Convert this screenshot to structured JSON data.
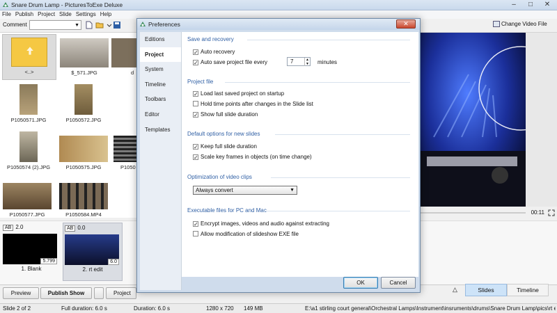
{
  "window": {
    "title": "Snare Drum Lamp - PicturesToExe Deluxe"
  },
  "menu": [
    "File",
    "Publish",
    "Project",
    "Slide",
    "Settings",
    "Help"
  ],
  "toolbar": {
    "comment_label": "Comment",
    "change_video_label": "Change Video File"
  },
  "browser": {
    "items": [
      {
        "caption": "<..>"
      },
      {
        "caption": "$_571.JPG"
      },
      {
        "caption": "d"
      },
      {
        "caption": "P1050571.JPG"
      },
      {
        "caption": "P1050572.JPG"
      },
      {
        "caption": "P1050574 (2).JPG"
      },
      {
        "caption": "P1050575.JPG"
      },
      {
        "caption": "P1050"
      },
      {
        "caption": "P1050577.JPG"
      },
      {
        "caption": "P1050584.MP4"
      }
    ]
  },
  "player": {
    "time": "00:11"
  },
  "slides": [
    {
      "ab_label": "AB",
      "transition": "2.0",
      "duration": "5.799",
      "name": "1. Blank"
    },
    {
      "ab_label": "AB",
      "transition": "0.0",
      "duration": "6.0",
      "name": "2. rt edit"
    }
  ],
  "bottom": {
    "preview_label": "Preview",
    "publish_label": "Publish Show",
    "project_options_label": "Project O",
    "tab_slides": "Slides",
    "tab_timeline": "Timeline"
  },
  "status": {
    "slide": "Slide 2 of 2",
    "full_duration": "Full duration: 6.0 s",
    "duration": "Duration: 6.0 s",
    "resolution": "1280 x 720",
    "size": "149 MB",
    "path": "E:\\a1 stirling court general\\Orchestral Lamps\\Instrument\\insruments\\drums\\Snare Drum Lamp\\pics\\rt edit."
  },
  "dialog": {
    "title": "Preferences",
    "close_glyph": "✕",
    "nav": [
      "Editions",
      "Project",
      "System",
      "Timeline",
      "Toolbars",
      "Editor",
      "Templates"
    ],
    "active_nav": "Project",
    "sections": {
      "save": {
        "title": "Save and recovery",
        "auto_recovery": {
          "label": "Auto recovery",
          "checked": true
        },
        "auto_save": {
          "label": "Auto save project file every",
          "checked": true,
          "value": "7",
          "unit": "minutes"
        }
      },
      "project_file": {
        "title": "Project file",
        "load_last": {
          "label": "Load last saved project on startup",
          "checked": true
        },
        "hold_time": {
          "label": "Hold time points after changes in the Slide list",
          "checked": false
        },
        "show_full": {
          "label": "Show full slide duration",
          "checked": true
        }
      },
      "defaults": {
        "title": "Default options for new slides",
        "keep_full": {
          "label": "Keep full slide duration",
          "checked": true
        },
        "scale_keys": {
          "label": "Scale key frames in objects (on time change)",
          "checked": true
        }
      },
      "video": {
        "title": "Optimization of video clips",
        "select_value": "Always convert"
      },
      "exe": {
        "title": "Executable files for PC and Mac",
        "encrypt": {
          "label": "Encrypt images, videos and audio against extracting",
          "checked": true
        },
        "allow_mod": {
          "label": "Allow modification of slideshow EXE file",
          "checked": false
        }
      }
    },
    "ok_label": "OK",
    "cancel_label": "Cancel"
  }
}
